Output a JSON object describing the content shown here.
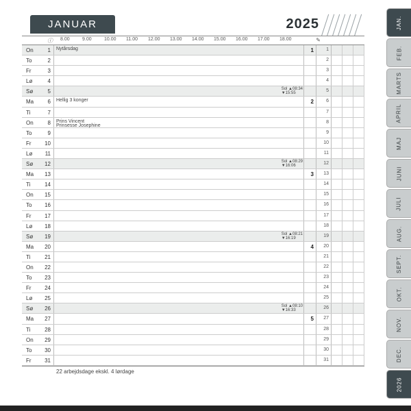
{
  "header": {
    "month": "JANUAR",
    "year": "2025"
  },
  "timescale": {
    "hours": [
      "8.00",
      "9.00",
      "10.00",
      "11.00",
      "12.00",
      "13.00",
      "14.00",
      "15.00",
      "16.00",
      "17.00",
      "18.00"
    ],
    "info_icon": "ⓘ",
    "pencil_icon": "✎"
  },
  "days": [
    {
      "dow": "On",
      "num": "1",
      "shade": true,
      "note": "Nytårsdag",
      "sun": "",
      "wk": "1",
      "ord": "1"
    },
    {
      "dow": "To",
      "num": "2",
      "shade": false,
      "note": "",
      "sun": "",
      "wk": "",
      "ord": "2"
    },
    {
      "dow": "Fr",
      "num": "3",
      "shade": false,
      "note": "",
      "sun": "",
      "wk": "",
      "ord": "3"
    },
    {
      "dow": "Lø",
      "num": "4",
      "shade": false,
      "note": "",
      "sun": "",
      "wk": "",
      "ord": "4"
    },
    {
      "dow": "Sø",
      "num": "5",
      "shade": true,
      "note": "",
      "sun": "Sol ▲08:34\n     ▼15:55",
      "wk": "",
      "ord": "5"
    },
    {
      "dow": "Ma",
      "num": "6",
      "shade": false,
      "note": "Hellig 3 konger",
      "sun": "",
      "wk": "2",
      "ord": "6"
    },
    {
      "dow": "Ti",
      "num": "7",
      "shade": false,
      "note": "",
      "sun": "",
      "wk": "",
      "ord": "7"
    },
    {
      "dow": "On",
      "num": "8",
      "shade": false,
      "note": "Prins Vincent\nPrinsesse Josephine",
      "sun": "",
      "wk": "",
      "ord": "8"
    },
    {
      "dow": "To",
      "num": "9",
      "shade": false,
      "note": "",
      "sun": "",
      "wk": "",
      "ord": "9"
    },
    {
      "dow": "Fr",
      "num": "10",
      "shade": false,
      "note": "",
      "sun": "",
      "wk": "",
      "ord": "10"
    },
    {
      "dow": "Lø",
      "num": "11",
      "shade": false,
      "note": "",
      "sun": "",
      "wk": "",
      "ord": "11"
    },
    {
      "dow": "Sø",
      "num": "12",
      "shade": true,
      "note": "",
      "sun": "Sol ▲08:29\n     ▼16:06",
      "wk": "",
      "ord": "12"
    },
    {
      "dow": "Ma",
      "num": "13",
      "shade": false,
      "note": "",
      "sun": "",
      "wk": "3",
      "ord": "13"
    },
    {
      "dow": "Ti",
      "num": "14",
      "shade": false,
      "note": "",
      "sun": "",
      "wk": "",
      "ord": "14"
    },
    {
      "dow": "On",
      "num": "15",
      "shade": false,
      "note": "",
      "sun": "",
      "wk": "",
      "ord": "15"
    },
    {
      "dow": "To",
      "num": "16",
      "shade": false,
      "note": "",
      "sun": "",
      "wk": "",
      "ord": "16"
    },
    {
      "dow": "Fr",
      "num": "17",
      "shade": false,
      "note": "",
      "sun": "",
      "wk": "",
      "ord": "17"
    },
    {
      "dow": "Lø",
      "num": "18",
      "shade": false,
      "note": "",
      "sun": "",
      "wk": "",
      "ord": "18"
    },
    {
      "dow": "Sø",
      "num": "19",
      "shade": true,
      "note": "",
      "sun": "Sol ▲08:21\n     ▼16:19",
      "wk": "",
      "ord": "19"
    },
    {
      "dow": "Ma",
      "num": "20",
      "shade": false,
      "note": "",
      "sun": "",
      "wk": "4",
      "ord": "20"
    },
    {
      "dow": "Ti",
      "num": "21",
      "shade": false,
      "note": "",
      "sun": "",
      "wk": "",
      "ord": "21"
    },
    {
      "dow": "On",
      "num": "22",
      "shade": false,
      "note": "",
      "sun": "",
      "wk": "",
      "ord": "22"
    },
    {
      "dow": "To",
      "num": "23",
      "shade": false,
      "note": "",
      "sun": "",
      "wk": "",
      "ord": "23"
    },
    {
      "dow": "Fr",
      "num": "24",
      "shade": false,
      "note": "",
      "sun": "",
      "wk": "",
      "ord": "24"
    },
    {
      "dow": "Lø",
      "num": "25",
      "shade": false,
      "note": "",
      "sun": "",
      "wk": "",
      "ord": "25"
    },
    {
      "dow": "Sø",
      "num": "26",
      "shade": true,
      "note": "",
      "sun": "Sol ▲08:10\n     ▼16:33",
      "wk": "",
      "ord": "26"
    },
    {
      "dow": "Ma",
      "num": "27",
      "shade": false,
      "note": "",
      "sun": "",
      "wk": "5",
      "ord": "27"
    },
    {
      "dow": "Ti",
      "num": "28",
      "shade": false,
      "note": "",
      "sun": "",
      "wk": "",
      "ord": "28"
    },
    {
      "dow": "On",
      "num": "29",
      "shade": false,
      "note": "",
      "sun": "",
      "wk": "",
      "ord": "29"
    },
    {
      "dow": "To",
      "num": "30",
      "shade": false,
      "note": "",
      "sun": "",
      "wk": "",
      "ord": "30"
    },
    {
      "dow": "Fr",
      "num": "31",
      "shade": false,
      "note": "",
      "sun": "",
      "wk": "",
      "ord": "31"
    }
  ],
  "footer": {
    "text": "22 arbejdsdage ekskl. 4 lørdage"
  },
  "tabs": [
    {
      "label": "JAN.",
      "active": true
    },
    {
      "label": "FEB.",
      "active": false
    },
    {
      "label": "MARTS",
      "active": false
    },
    {
      "label": "APRIL",
      "active": false
    },
    {
      "label": "MAJ",
      "active": false
    },
    {
      "label": "JUNI",
      "active": false
    },
    {
      "label": "JULI",
      "active": false
    },
    {
      "label": "AUG.",
      "active": false
    },
    {
      "label": "SEPT.",
      "active": false
    },
    {
      "label": "OKT.",
      "active": false
    },
    {
      "label": "NOV.",
      "active": false
    },
    {
      "label": "DEC.",
      "active": false
    },
    {
      "label": "2026",
      "active": false,
      "year": true
    }
  ]
}
